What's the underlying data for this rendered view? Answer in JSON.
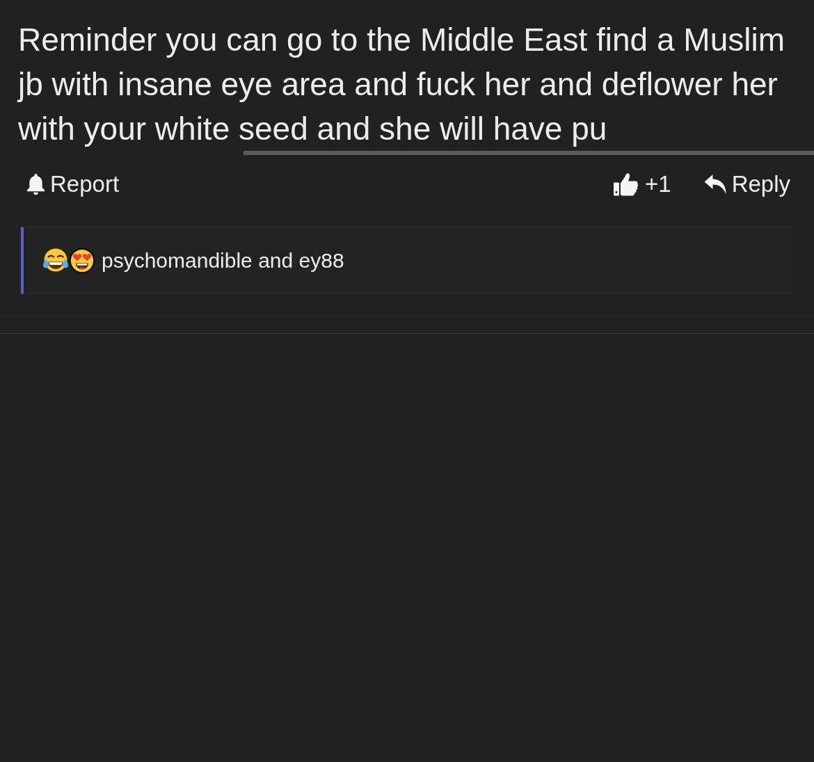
{
  "post": {
    "text": "Reminder you can go to the Middle East find a Muslim jb with insane eye area and fuck her and deflower her with your white seed and she will have pu"
  },
  "actions": [
    {
      "kind": "report",
      "label": "Report"
    },
    {
      "kind": "upvote",
      "label": "+1"
    },
    {
      "kind": "reply",
      "label": "Reply"
    }
  ],
  "reactions": {
    "emojis": [
      {
        "kind": "laughing_tears"
      },
      {
        "kind": "heart_eyes"
      }
    ],
    "text": "psychomandible and ey88"
  }
}
